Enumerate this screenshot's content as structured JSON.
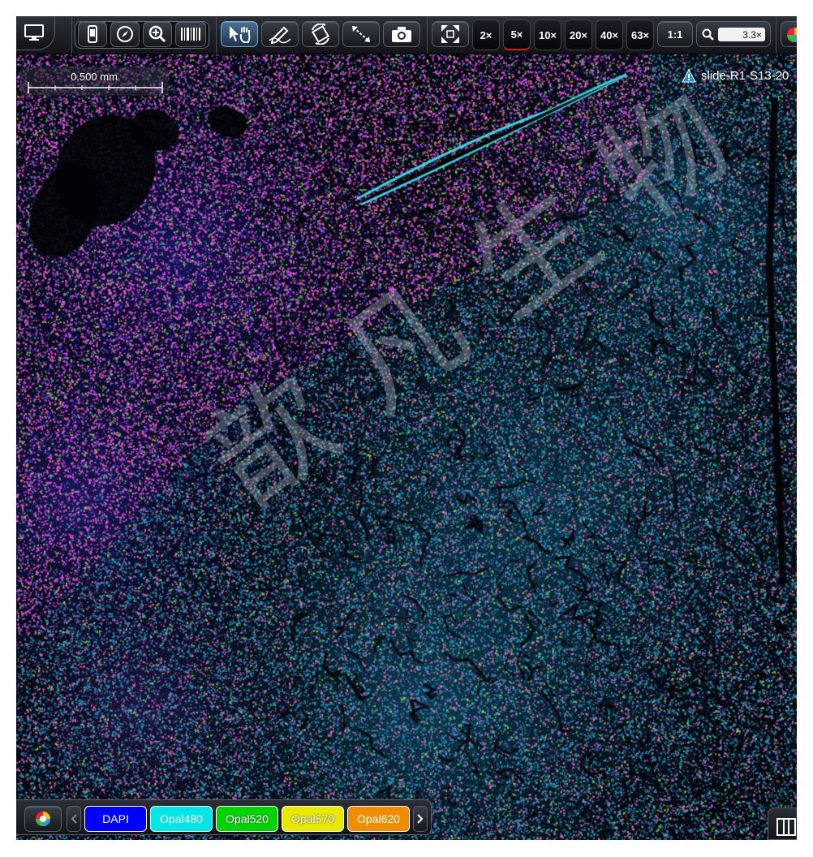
{
  "toolbar": {
    "magnifications": [
      "2×",
      "5×",
      "10×",
      "20×",
      "40×",
      "63×"
    ],
    "active_magnification": "5×",
    "one_to_one": "1:1",
    "zoom_value": "3.3×"
  },
  "scale_bar": {
    "label": "0.500 mm"
  },
  "slide": {
    "name": "slide-R1-S13-20"
  },
  "watermark": {
    "text": "歆 凡 生 物"
  },
  "channels": [
    {
      "label": "DAPI",
      "color": "#0000ff"
    },
    {
      "label": "Opal480",
      "color": "#00e5e5"
    },
    {
      "label": "Opal520",
      "color": "#00d400"
    },
    {
      "label": "Opal570",
      "color": "#e8e800"
    },
    {
      "label": "Opal620",
      "color": "#f08c00"
    }
  ],
  "colors": {
    "tissue_cyan": "#2aa6c8",
    "tissue_magenta": "#e050e0",
    "tissue_blue": "#2a2ad8",
    "background": "#05070f"
  }
}
